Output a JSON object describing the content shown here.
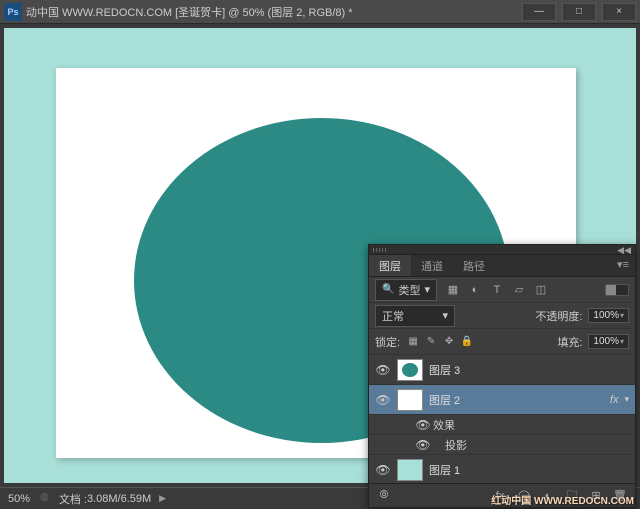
{
  "titlebar": {
    "ps": "Ps",
    "title": "动中国 WWW.REDOCN.COM [圣诞贺卡] @ 50% (图层 2, RGB/8) *",
    "min": "—",
    "max": "□",
    "close": "×"
  },
  "status": {
    "zoom": "50%",
    "doc_label": "文档 :",
    "doc_size": "3.08M/6.59M"
  },
  "panel": {
    "tabs": {
      "layers": "图层",
      "channels": "通道",
      "paths": "路径"
    },
    "kind": {
      "label": "类型"
    },
    "blend": {
      "mode": "正常",
      "opacity_label": "不透明度:",
      "opacity": "100%"
    },
    "lock": {
      "label": "锁定:",
      "fill_label": "填充:",
      "fill": "100%"
    },
    "layers": [
      {
        "name": "图层 3"
      },
      {
        "name": "图层 2",
        "fx": "fx",
        "effects": "效果",
        "shadow": "投影"
      },
      {
        "name": "图层 1"
      }
    ],
    "link_icon": "⦾"
  },
  "watermark": "红动中国 WWW.REDOCN.COM"
}
